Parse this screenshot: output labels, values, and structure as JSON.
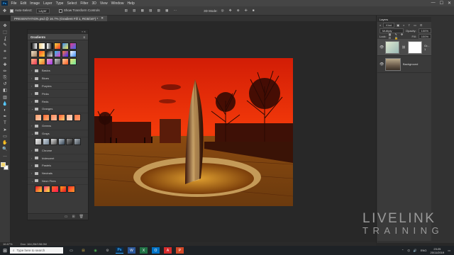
{
  "menubar": {
    "app_icon": "Ps",
    "items": [
      "File",
      "Edit",
      "Image",
      "Layer",
      "Type",
      "Select",
      "Filter",
      "3D",
      "View",
      "Window",
      "Help"
    ],
    "window_controls": [
      "—",
      "☐",
      "✕"
    ]
  },
  "optionsbar": {
    "auto_select_label": "Auto-Select:",
    "auto_select_value": "Layer",
    "transform_label": "Show Transform Controls",
    "mode_label": "3D Mode:"
  },
  "document": {
    "tab_title": "PRESENTATION.psd @ 16.7% (Gradient Fill 1, RGB/16*) *"
  },
  "toolbar": {
    "tools": [
      "move-tool",
      "marquee-tool",
      "lasso-tool",
      "quick-select-tool",
      "crop-tool",
      "eyedropper-tool",
      "healing-tool",
      "brush-tool",
      "stamp-tool",
      "history-brush-tool",
      "eraser-tool",
      "gradient-tool",
      "blur-tool",
      "dodge-tool",
      "pen-tool",
      "type-tool",
      "path-select-tool",
      "shape-tool",
      "hand-tool",
      "zoom-tool",
      "more-tools"
    ],
    "tool_glyphs": [
      "✥",
      "⬚",
      "ʆ",
      "✎",
      "⌗",
      "✑",
      "✚",
      "✏",
      "⎘",
      "↺",
      "◧",
      "▥",
      "💧",
      "◐",
      "✒",
      "T",
      "➤",
      "▭",
      "✋",
      "🔍",
      "…"
    ],
    "foreground_color": "#f4d66e",
    "background_color": "#ffffff"
  },
  "gradients_panel": {
    "title": "Gradients",
    "header_controls": "« ✕",
    "menu_icon": "≡",
    "folders": [
      {
        "label": "Basics",
        "expanded": false
      },
      {
        "label": "Blues",
        "expanded": false
      },
      {
        "label": "Purples",
        "expanded": false
      },
      {
        "label": "Pinks",
        "expanded": false
      },
      {
        "label": "Reds",
        "expanded": false
      },
      {
        "label": "Oranges",
        "expanded": true
      },
      {
        "label": "Greens",
        "expanded": false
      },
      {
        "label": "Grays",
        "expanded": true
      },
      {
        "label": "Chrome",
        "expanded": false
      },
      {
        "label": "Iridescent",
        "expanded": false
      },
      {
        "label": "Pastels",
        "expanded": false
      },
      {
        "label": "Neutrals",
        "expanded": false
      },
      {
        "label": "Neon Fires",
        "expanded": true
      }
    ],
    "footer_icons": [
      "folder-icon",
      "new-icon",
      "trash-icon"
    ],
    "footer_glyphs": [
      "▭",
      "⊞",
      "🗑"
    ]
  },
  "layers_panel": {
    "tab": "Layers",
    "kind_filter": "Kind",
    "blend_mode": "Multiply",
    "opacity_label": "Opacity:",
    "opacity_value": "100%",
    "lock_label": "Lock:",
    "fill_label": "Fill:",
    "fill_value": "100%",
    "layers": [
      {
        "name": "Gr... 1",
        "selected": true,
        "has_mask": true
      },
      {
        "name": "Background",
        "selected": false,
        "has_mask": false
      }
    ]
  },
  "status_bar": {
    "zoom": "16.67%",
    "doc_size": "Doc: 164,2M/198.0M"
  },
  "brand": {
    "line1": "LIVELINK",
    "line2": "TRAINING"
  },
  "taskbar": {
    "search_placeholder": "Type here to search",
    "apps": [
      "file-explorer",
      "chrome",
      "settings",
      "photoshop",
      "word",
      "excel",
      "outlook",
      "acrobat",
      "powerpoint"
    ],
    "app_glyphs": [
      "⊟",
      "◉",
      "⚙",
      "Ps",
      "W",
      "X",
      "O",
      "A",
      "P"
    ],
    "app_colors": [
      "#e8c14a",
      "#4caf50",
      "#aaaaaa",
      "#31a8ff",
      "#2b579a",
      "#217346",
      "#0072c6",
      "#d62c2c",
      "#d24726"
    ],
    "tray_lang": "ENG",
    "time": "23:25",
    "date": "20/11/2019"
  }
}
